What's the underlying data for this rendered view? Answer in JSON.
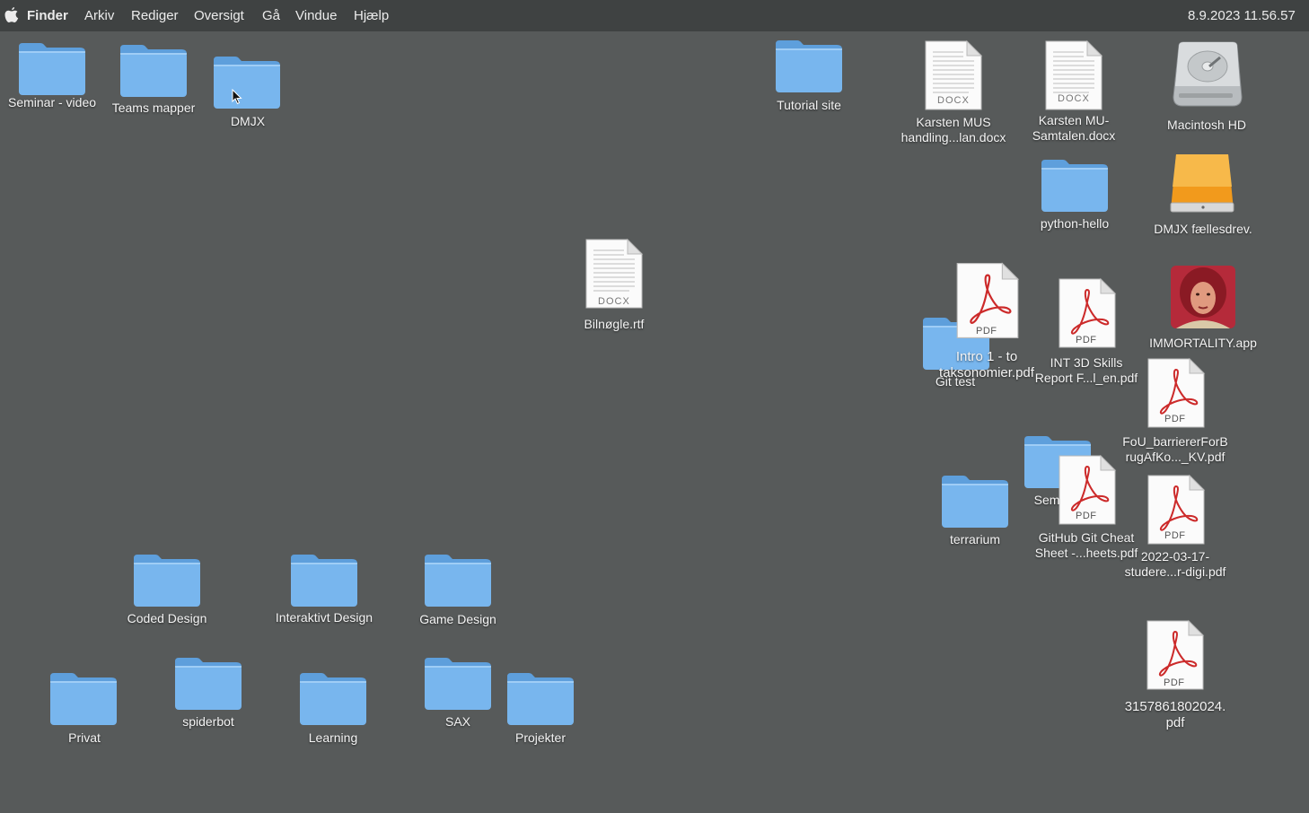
{
  "menubar": {
    "app_name": "Finder",
    "items": [
      "Arkiv",
      "Rediger",
      "Oversigt",
      "Gå",
      "Vindue",
      "Hjælp"
    ],
    "clock": "8.9.2023 11.56.57"
  },
  "desktop": {
    "seminar_video": "Seminar - video",
    "teams_mapper": "Teams mapper",
    "dmjx": "DMJX",
    "tutorial_site": "Tutorial site",
    "karsten_mus_1": "Karsten MUS",
    "karsten_mus_2": "handling...lan.docx",
    "karsten_mu_1": "Karsten MU-",
    "karsten_mu_2": "Samtalen.docx",
    "macintosh_hd": "Macintosh HD",
    "python_hello": "python-hello",
    "dmjx_faellesdrev": "DMJX fællesdrev.",
    "bilnogle": "Bilnøgle.rtf",
    "intro_1": "Intro 1 - to",
    "intro_2": "taksonomier.pdf",
    "git_test": "Git test",
    "int3d_1": "INT 3D Skills",
    "int3d_2": "Report F...l_en.pdf",
    "immortality": "IMMORTALITY.app",
    "fou_1": "FoU_barriererForB",
    "fou_2": "rugAfKo..._KV.pdf",
    "sem_partial": "Sem",
    "github_1": "GitHub Git Cheat",
    "github_2": "Sheet -...heets.pdf",
    "terrarium": "terrarium",
    "pdf2022_1": "2022-03-17-",
    "pdf2022_2": "studere...r-digi.pdf",
    "num_1": "3157861802024.",
    "num_2": "pdf",
    "coded_design": "Coded Design",
    "interaktivt_design": "Interaktivt Design",
    "game_design": "Game Design",
    "privat": "Privat",
    "spiderbot": "spiderbot",
    "learning": "Learning",
    "sax": "SAX",
    "projekter": "Projekter"
  },
  "icon_labels": {
    "pdf": "PDF",
    "docx": "DOCX"
  },
  "colors": {
    "desktop": "#575a5a",
    "menubar": "#3f4242",
    "folder_front": "#78b6ee",
    "folder_back": "#5e9fdc",
    "pdf_red": "#cc2a2a",
    "drive_orange": "#f29a1c"
  }
}
